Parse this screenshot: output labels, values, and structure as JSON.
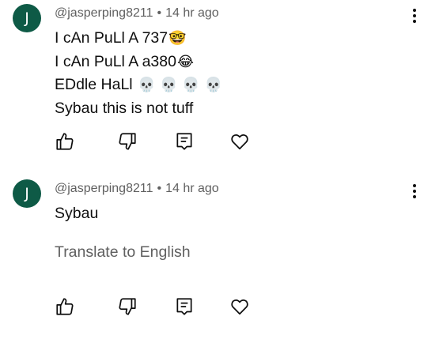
{
  "comments": [
    {
      "avatar_letter": "J",
      "avatar_color": "#0e5a46",
      "author": "@jasperping8211",
      "separator": "•",
      "time": "14 hr ago",
      "lines": [
        {
          "text": "I cAn PuLl A 737",
          "emoji": "🤓"
        },
        {
          "text": "I cAn PuLl A a380",
          "emoji": "😂"
        },
        {
          "text": "EDdle HaLl",
          "emoji": "💀 💀 💀 💀"
        },
        {
          "text": "Sybau this is not tuff",
          "emoji": ""
        }
      ],
      "actions": [
        "like-icon",
        "dislike-icon",
        "reply-icon",
        "heart-icon"
      ]
    },
    {
      "avatar_letter": "J",
      "avatar_color": "#0e5a46",
      "author": "@jasperping8211",
      "separator": "•",
      "time": "14 hr ago",
      "lines": [
        {
          "text": "Sybau"
        }
      ],
      "translate_label": "Translate to English",
      "actions": [
        "like-icon",
        "dislike-icon",
        "reply-icon",
        "heart-icon"
      ]
    }
  ]
}
